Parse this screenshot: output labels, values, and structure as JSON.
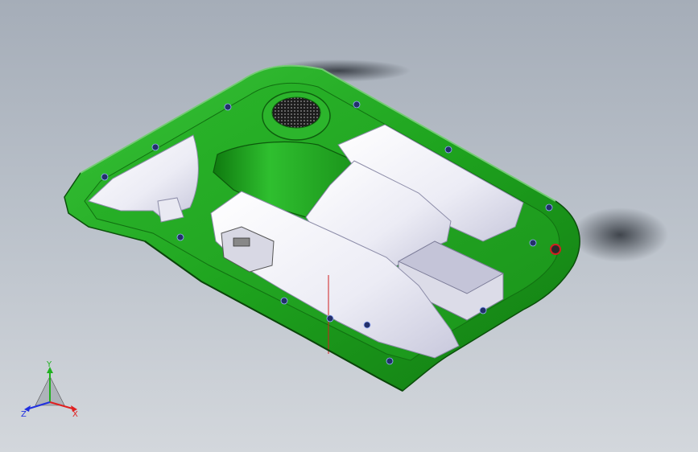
{
  "viewport": {
    "model_type": "3D CAD part - green housing shell with white inner covers (isometric view)",
    "background_top": "#a5adb8",
    "background_bottom": "#d3d7dc"
  },
  "colors": {
    "shell_green": "#1ea31e",
    "shell_green_dark": "#0f6d0f",
    "shell_green_light": "#6bd36b",
    "cover_white": "#f2f2f8",
    "cover_shade": "#c9c9dd",
    "fastener_blue": "#23306b",
    "axis_x": "#e02020",
    "axis_y": "#20b020",
    "axis_z": "#2030e0"
  },
  "triad": {
    "x_label": "X",
    "y_label": "Y",
    "z_label": "Z"
  }
}
